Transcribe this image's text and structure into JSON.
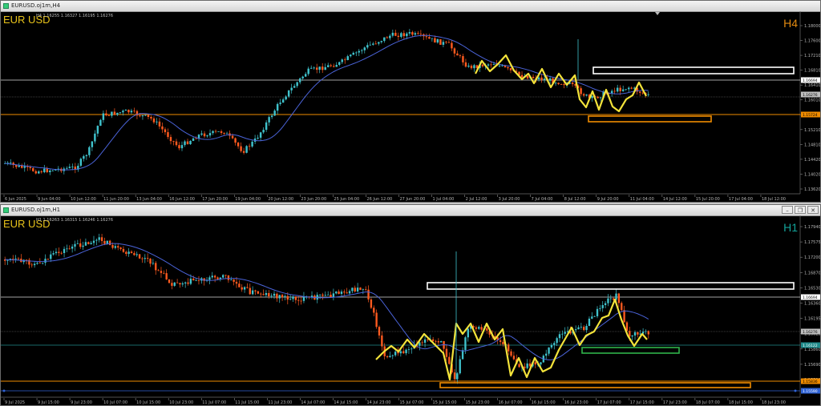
{
  "top": {
    "title": "EURUSD.oj1m,H4",
    "symbol": "EUR USD",
    "timeframe": "H4",
    "timeframe_color": "#e28a10",
    "ohlc": "H4  1.16255 1.16327 1.16195 1.16276",
    "price_axis": [
      "1.18000",
      "1.17600",
      "1.17210",
      "1.16810",
      "1.16410",
      "1.16010",
      "1.15610",
      "1.15210",
      "1.14810",
      "1.14420",
      "1.14020",
      "1.13620"
    ],
    "price_tags": [
      {
        "label": "1.16694",
        "color": "#ffffff",
        "text": "#000000"
      },
      {
        "label": "1.16276",
        "color": "#bfbfbf",
        "text": "#000000"
      },
      {
        "label": "1.15724",
        "color": "#f08c00",
        "text": "#000000"
      }
    ],
    "time_axis": [
      "6 Jun 2025",
      "9 Jun 04:00",
      "10 Jun 12:00",
      "11 Jun 20:00",
      "13 Jun 04:00",
      "16 Jun 12:00",
      "17 Jun 20:00",
      "19 Jun 04:00",
      "20 Jun 12:00",
      "23 Jun 20:00",
      "25 Jun 04:00",
      "26 Jun 12:00",
      "27 Jun 20:00",
      "1 Jul 04:00",
      "2 Jul 12:00",
      "3 Jul 20:00",
      "7 Jul 04:00",
      "8 Jul 12:00",
      "9 Jul 20:00",
      "11 Jul 04:00",
      "14 Jul 12:00",
      "15 Jul 20:00",
      "17 Jul 04:00",
      "18 Jul 12:00"
    ]
  },
  "bottom": {
    "title": "EURUSD.oj1m,H1",
    "symbol": "EUR USD",
    "timeframe": "H1",
    "timeframe_color": "#13a39a",
    "ohlc": "H1  1.16263 1.16315 1.16246 1.16276",
    "price_axis": [
      "1.17940",
      "1.17575",
      "1.17200",
      "1.16870",
      "1.16530",
      "1.16360",
      "1.16195",
      "1.16025",
      "1.15860",
      "1.15690",
      "1.15520"
    ],
    "price_tags": [
      {
        "label": "1.16694",
        "color": "#ffffff",
        "text": "#000000"
      },
      {
        "label": "1.16276",
        "color": "#bfbfbf",
        "text": "#000000"
      },
      {
        "label": "1.16122",
        "color": "#1f8b8b",
        "text": "#ffffff"
      },
      {
        "label": "1.15836",
        "color": "#f08c00",
        "text": "#000000"
      },
      {
        "label": "1.15590",
        "color": "#2f63d6",
        "text": "#ffffff"
      }
    ],
    "time_axis": [
      "9 Jul 2025",
      "9 Jul 15:00",
      "9 Jul 23:00",
      "10 Jul 07:00",
      "10 Jul 15:00",
      "10 Jul 23:00",
      "11 Jul 07:00",
      "11 Jul 15:00",
      "11 Jul 23:00",
      "14 Jul 07:00",
      "14 Jul 15:00",
      "14 Jul 23:00",
      "15 Jul 07:00",
      "15 Jul 15:00",
      "15 Jul 23:00",
      "16 Jul 07:00",
      "16 Jul 15:00",
      "16 Jul 23:00",
      "17 Jul 07:00",
      "17 Jul 15:00",
      "17 Jul 23:00",
      "18 Jul 07:00",
      "18 Jul 15:00",
      "18 Jul 23:00"
    ]
  },
  "colors": {
    "bull": "#3fc2cc",
    "bear": "#ff5a1f",
    "ma": "#4a63d8",
    "zigzag": "#f3e33a"
  }
}
